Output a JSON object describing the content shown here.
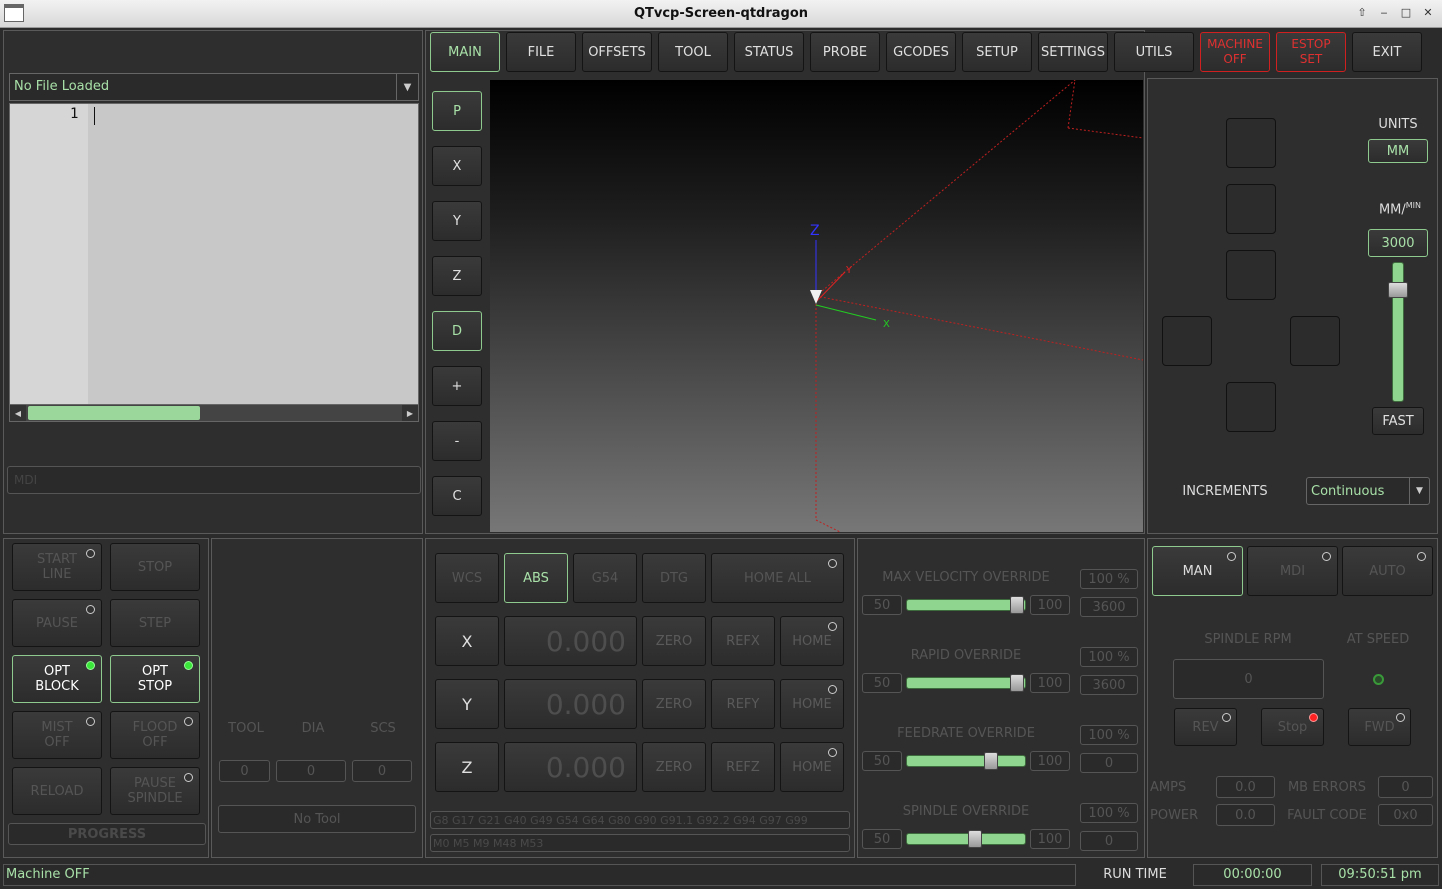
{
  "window": {
    "title": "QTvcp-Screen-qtdragon"
  },
  "file": {
    "selected": "No File Loaded",
    "line_number": "1",
    "mdi_placeholder": "MDI"
  },
  "tabs": [
    "MAIN",
    "FILE",
    "OFFSETS",
    "TOOL",
    "STATUS",
    "PROBE",
    "GCODES",
    "SETUP",
    "SETTINGS",
    "UTILS"
  ],
  "machine_btn": {
    "line1": "MACHINE",
    "line2": "OFF"
  },
  "estop_btn": {
    "line1": "ESTOP",
    "line2": "SET"
  },
  "exit_label": "EXIT",
  "view_buttons": [
    "P",
    "X",
    "Y",
    "Z",
    "D",
    "+",
    "-",
    "C"
  ],
  "axis_labels": {
    "x": "X",
    "y": "Y",
    "z": "Z"
  },
  "jog": {
    "units_label": "UNITS",
    "units_value": "MM",
    "rate_label": "MM/",
    "rate_sup": "MIN",
    "rate_value": "3000",
    "fast_label": "FAST",
    "increments_label": "INCREMENTS",
    "increments_value": "Continuous"
  },
  "program": {
    "start_line": [
      "START",
      "LINE"
    ],
    "stop": "STOP",
    "pause": "PAUSE",
    "step": "STEP",
    "opt_block": [
      "OPT",
      "BLOCK"
    ],
    "opt_stop": [
      "OPT",
      "STOP"
    ],
    "mist": [
      "MIST",
      "OFF"
    ],
    "flood": [
      "FLOOD",
      "OFF"
    ],
    "reload": "RELOAD",
    "pause_spindle": [
      "PAUSE",
      "SPINDLE"
    ],
    "progress": "PROGRESS"
  },
  "tool": {
    "headers": [
      "TOOL",
      "DIA",
      "SCS"
    ],
    "values": [
      "0",
      "0",
      "0"
    ],
    "name": "No Tool"
  },
  "dro": {
    "wcs": "WCS",
    "abs": "ABS",
    "g54": "G54",
    "dtg": "DTG",
    "home_all": "HOME ALL",
    "axes": [
      {
        "name": "X",
        "value": "0.000",
        "zero": "ZERO",
        "ref": "REFX",
        "home": "HOME"
      },
      {
        "name": "Y",
        "value": "0.000",
        "zero": "ZERO",
        "ref": "REFY",
        "home": "HOME"
      },
      {
        "name": "Z",
        "value": "0.000",
        "zero": "ZERO",
        "ref": "REFZ",
        "home": "HOME"
      }
    ],
    "gcodes": "G8 G17 G21 G40 G49 G54 G64 G80 G90 G91.1 G92.2 G94 G97 G99",
    "mcodes": "M0 M5 M9 M48 M53"
  },
  "overrides": [
    {
      "label": "MAX VELOCITY OVERRIDE",
      "min": "50",
      "max": "100",
      "pct": "100 %",
      "rate": "3600",
      "value": 1.0
    },
    {
      "label": "RAPID OVERRIDE",
      "min": "50",
      "max": "100",
      "pct": "100 %",
      "rate": "3600",
      "value": 1.0
    },
    {
      "label": "FEEDRATE OVERRIDE",
      "min": "50",
      "max": "100",
      "pct": "100 %",
      "rate": "0",
      "value": 0.75
    },
    {
      "label": "SPINDLE OVERRIDE",
      "min": "50",
      "max": "100",
      "pct": "100 %",
      "rate": "0",
      "value": 0.6
    }
  ],
  "mode": {
    "man": "MAN",
    "mdi": "MDI",
    "auto": "AUTO"
  },
  "spindle": {
    "rpm_label": "SPINDLE RPM",
    "at_speed": "AT SPEED",
    "rpm": "0",
    "rev": "REV",
    "stop": "Stop",
    "fwd": "FWD",
    "amps_label": "AMPS",
    "amps": "0.0",
    "mb_label": "MB ERRORS",
    "mb": "0",
    "power_label": "POWER",
    "power": "0.0",
    "fault_label": "FAULT CODE",
    "fault": "0x0"
  },
  "status": {
    "message": "Machine OFF",
    "run_label": "RUN TIME",
    "run_time": "00:00:00",
    "clock": "09:50:51 pm"
  }
}
